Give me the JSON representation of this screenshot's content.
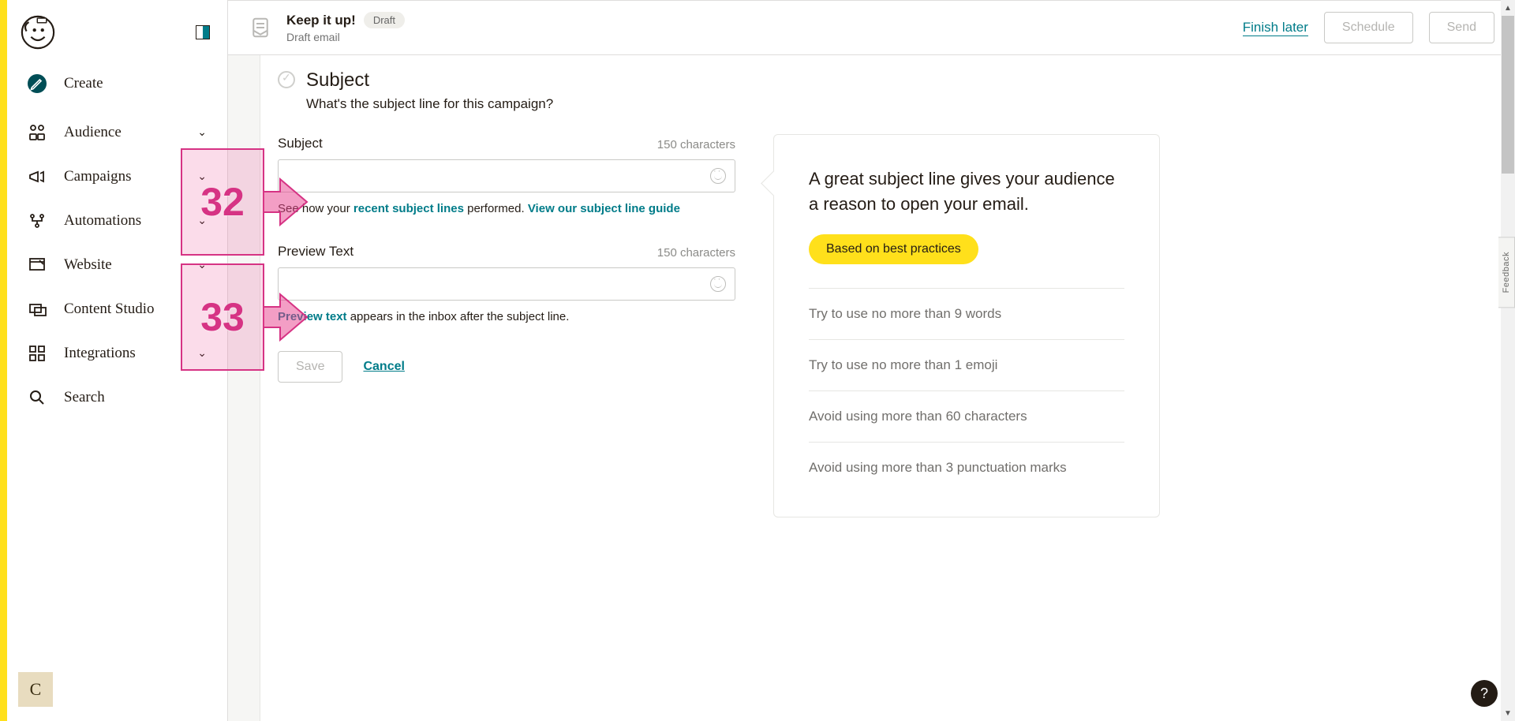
{
  "sidebar": {
    "items": [
      {
        "label": "Create"
      },
      {
        "label": "Audience",
        "expandable": true
      },
      {
        "label": "Campaigns",
        "expandable": true
      },
      {
        "label": "Automations",
        "expandable": true
      },
      {
        "label": "Website",
        "expandable": true
      },
      {
        "label": "Content Studio"
      },
      {
        "label": "Integrations",
        "expandable": true
      },
      {
        "label": "Search"
      }
    ],
    "avatar_letter": "C"
  },
  "topbar": {
    "title": "Keep it up!",
    "status": "Draft",
    "subtitle": "Draft email",
    "finish_later": "Finish later",
    "schedule": "Schedule",
    "send": "Send"
  },
  "subject_section": {
    "title": "Subject",
    "subtitle": "What's the subject line for this campaign?",
    "subject_label": "Subject",
    "subject_counter": "150 characters",
    "subject_helper_prefix": "See how your ",
    "subject_helper_link1": "recent subject lines",
    "subject_helper_mid": " performed. ",
    "subject_helper_link2": "View our subject line guide",
    "preview_label": "Preview Text",
    "preview_counter": "150 characters",
    "preview_helper_link": "Preview text",
    "preview_helper_rest": " appears in the inbox after the subject line.",
    "save": "Save",
    "cancel": "Cancel"
  },
  "tips": {
    "headline": "A great subject line gives your audience a reason to open your email.",
    "pill": "Based on best practices",
    "rows": [
      "Try to use no more than 9 words",
      "Try to use no more than 1 emoji",
      "Avoid using more than 60 characters",
      "Avoid using more than 3 punctuation marks"
    ]
  },
  "feedback_label": "Feedback",
  "annotations": {
    "a1": "32",
    "a2": "33"
  }
}
